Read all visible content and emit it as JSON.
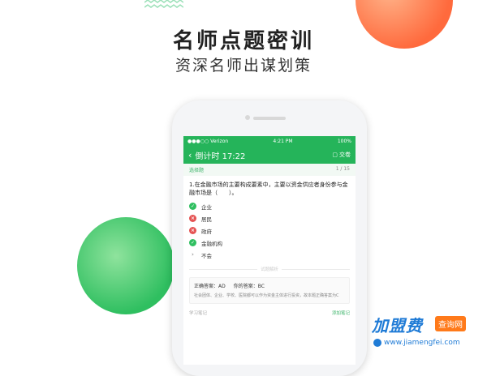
{
  "hero": {
    "title": "名师点题密训",
    "subtitle": "资深名师出谋划策"
  },
  "status_bar": {
    "carrier": "●●●○○ Verizon",
    "time": "4:21 PM",
    "battery": "100%"
  },
  "app_bar": {
    "title": "倒计时 17:22",
    "submit_label": "交卷"
  },
  "question_meta": {
    "type": "选择题",
    "count": "1 / 15"
  },
  "question": {
    "text": "1.在金融市场的主要构成要素中，主要以资金供应者身份参与金融市场是（　　）。",
    "options": [
      {
        "label": "企业",
        "status": "correct"
      },
      {
        "label": "居民",
        "status": "wrong"
      },
      {
        "label": "政府",
        "status": "wrong"
      },
      {
        "label": "金融机构",
        "status": "correct"
      },
      {
        "label": "不会",
        "status": "none"
      }
    ]
  },
  "divider_label": "试题解析",
  "answer": {
    "correct_label": "正确答案：AD",
    "yours_label": "你的答案：BC",
    "analysis": "社会团体、企业、学校、医院都可以作为资金主体进行投资，故本题正确答案为C"
  },
  "notes": {
    "label": "学习笔记",
    "add": "添加笔记"
  },
  "watermark": {
    "brand": "加盟费",
    "tag": "查询网",
    "url": "www.jiamengfei.com"
  },
  "colors": {
    "accent": "#25b45a",
    "correct": "#2fbf60",
    "wrong": "#e55353",
    "orange_circle": "#ff6a3d",
    "watermark_blue": "#1f7bd6"
  }
}
